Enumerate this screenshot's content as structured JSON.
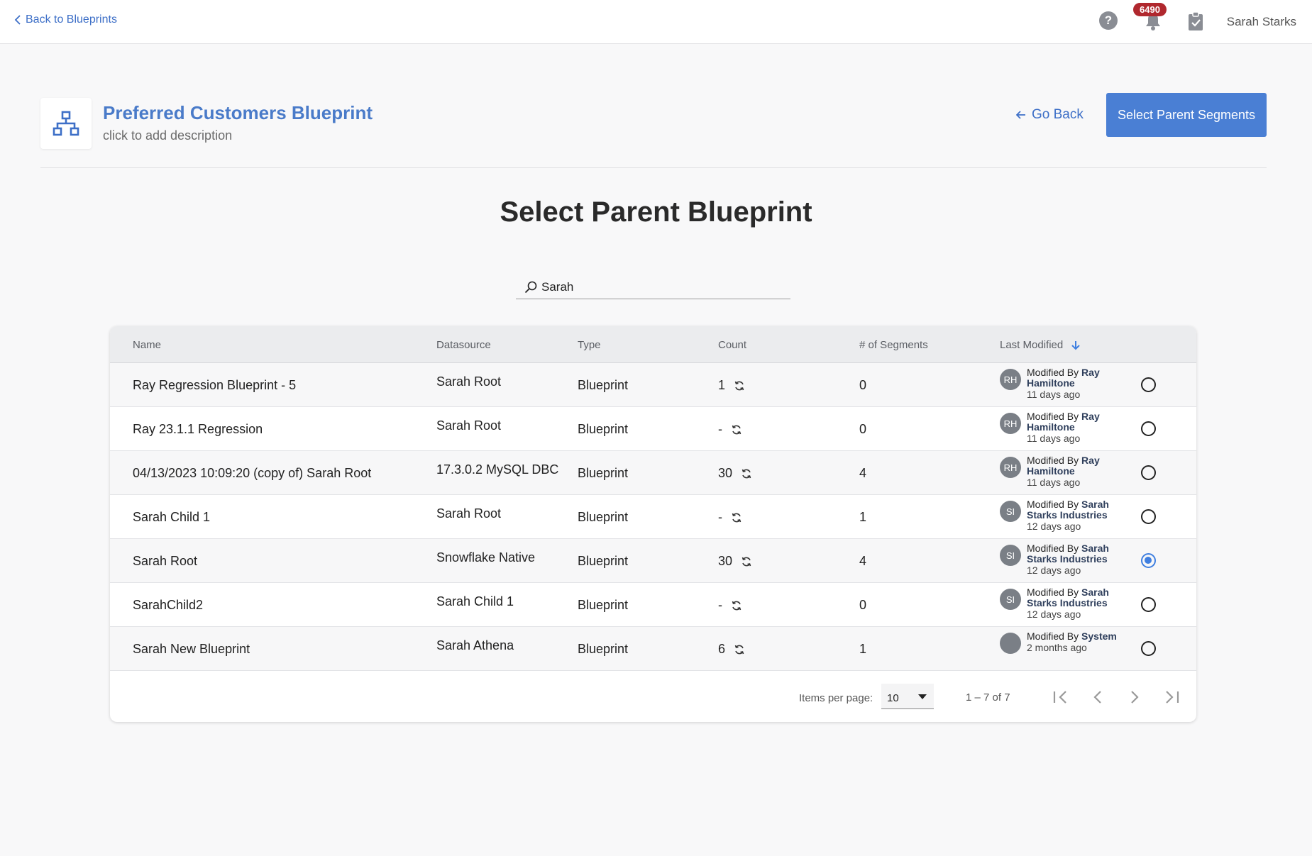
{
  "topbar": {
    "back_label": "Back to Blueprints",
    "help_glyph": "?",
    "notification_count": "6490",
    "user_name": "Sarah Starks"
  },
  "header": {
    "title": "Preferred Customers Blueprint",
    "description": "click to add description",
    "go_back_label": "Go Back",
    "primary_button_label": "Select Parent Segments"
  },
  "page_heading": "Select Parent Blueprint",
  "search": {
    "value": "Sarah",
    "icon": "search-icon"
  },
  "table": {
    "columns": {
      "name": "Name",
      "datasource": "Datasource",
      "type": "Type",
      "count": "Count",
      "segments": "# of Segments",
      "last_modified": "Last Modified"
    },
    "rows": [
      {
        "name": "Ray Regression Blueprint - 5",
        "datasource": "Sarah Root",
        "type": "Blueprint",
        "count": "1",
        "segments": "0",
        "avatar": "RH",
        "modified_prefix": "Modified By ",
        "modified_by": "Ray Hamiltone",
        "modified_ago": "11 days ago",
        "selected": false
      },
      {
        "name": "Ray 23.1.1 Regression",
        "datasource": "Sarah Root",
        "type": "Blueprint",
        "count": "-",
        "segments": "0",
        "avatar": "RH",
        "modified_prefix": "Modified By ",
        "modified_by": "Ray Hamiltone",
        "modified_ago": "11 days ago",
        "selected": false
      },
      {
        "name": "04/13/2023 10:09:20 (copy of) Sarah Root",
        "datasource": "17.3.0.2 MySQL DBC",
        "type": "Blueprint",
        "count": "30",
        "segments": "4",
        "avatar": "RH",
        "modified_prefix": "Modified By ",
        "modified_by": "Ray Hamiltone",
        "modified_ago": "11 days ago",
        "selected": false
      },
      {
        "name": "Sarah Child 1",
        "datasource": "Sarah Root",
        "type": "Blueprint",
        "count": "-",
        "segments": "1",
        "avatar": "SI",
        "modified_prefix": "Modified By ",
        "modified_by": "Sarah Starks Industries",
        "modified_ago": "12 days ago",
        "selected": false
      },
      {
        "name": "Sarah Root",
        "datasource": "Snowflake Native",
        "type": "Blueprint",
        "count": "30",
        "segments": "4",
        "avatar": "SI",
        "modified_prefix": "Modified By ",
        "modified_by": "Sarah Starks Industries",
        "modified_ago": "12 days ago",
        "selected": true
      },
      {
        "name": "SarahChild2",
        "datasource": "Sarah Child 1",
        "type": "Blueprint",
        "count": "-",
        "segments": "0",
        "avatar": "SI",
        "modified_prefix": "Modified By ",
        "modified_by": "Sarah Starks Industries",
        "modified_ago": "12 days ago",
        "selected": false
      },
      {
        "name": "Sarah New Blueprint",
        "datasource": "Sarah Athena",
        "type": "Blueprint",
        "count": "6",
        "segments": "1",
        "avatar": "",
        "modified_prefix": "Modified By ",
        "modified_by": "System",
        "modified_ago": "2 months ago",
        "selected": false
      }
    ]
  },
  "pagination": {
    "items_per_page_label": "Items per page:",
    "items_per_page_value": "10",
    "range_label": "1 – 7 of 7"
  },
  "colors": {
    "accent": "#4a7fd4",
    "link": "#3d6fc7",
    "badge": "#b0282e",
    "selected_radio": "#3f7fe0"
  }
}
